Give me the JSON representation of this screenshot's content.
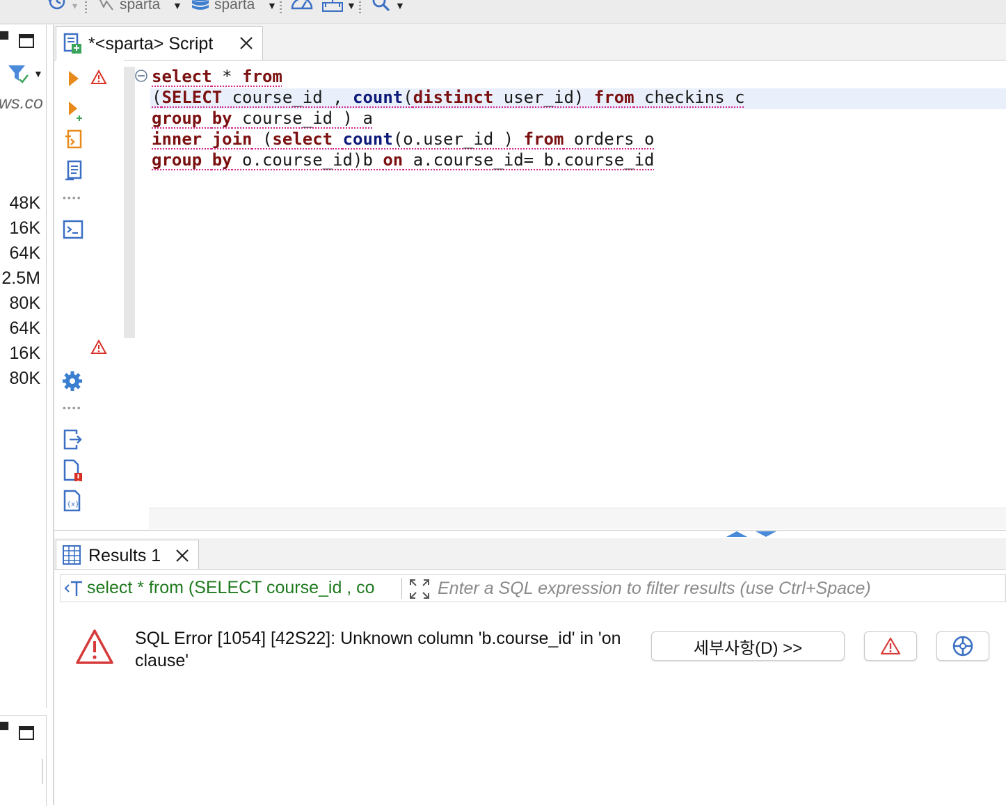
{
  "toolbar": {
    "datasource_label": "sparta",
    "schema_label": "sparta"
  },
  "left_panel": {
    "partial_text": "ws.co",
    "sizes": [
      "48K",
      "16K",
      "64K",
      "2.5M",
      "80K",
      "64K",
      "16K",
      "80K"
    ]
  },
  "editor": {
    "tab_label": "*<sparta> Script",
    "code_lines": [
      "select * from",
      "(SELECT course_id , count(distinct user_id) from checkins c",
      "group by course_id ) a",
      "inner join (select count(o.user_id ) from orders o",
      "group by o.course_id)b on a.course_id= b.course_id"
    ]
  },
  "results": {
    "tab_label": "Results 1",
    "query_preview": "select * from (SELECT course_id , co",
    "filter_placeholder": "Enter a SQL expression to filter results (use Ctrl+Space)",
    "error_message": "SQL Error [1054] [42S22]: Unknown column 'b.course_id' in 'on clause'",
    "details_button": "세부사항(D) >>"
  }
}
